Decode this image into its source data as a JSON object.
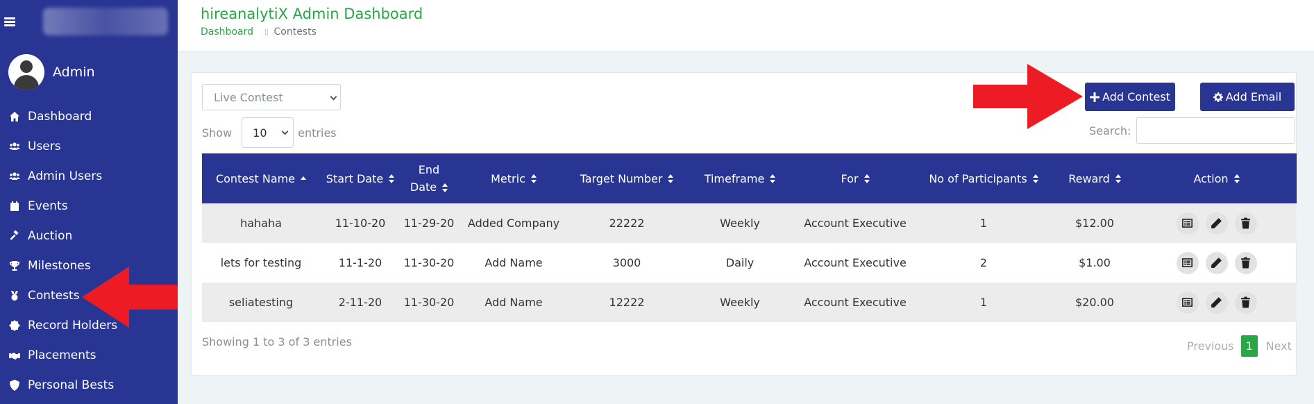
{
  "sidebar": {
    "user_name": "Admin",
    "items": [
      {
        "label": "Dashboard",
        "icon": "home-icon"
      },
      {
        "label": "Users",
        "icon": "users-icon"
      },
      {
        "label": "Admin Users",
        "icon": "users-icon"
      },
      {
        "label": "Events",
        "icon": "calendar-icon"
      },
      {
        "label": "Auction",
        "icon": "gavel-icon"
      },
      {
        "label": "Milestones",
        "icon": "trophy-icon"
      },
      {
        "label": "Contests",
        "icon": "medal-icon"
      },
      {
        "label": "Record Holders",
        "icon": "badge-icon"
      },
      {
        "label": "Placements",
        "icon": "handshake-icon"
      },
      {
        "label": "Personal Bests",
        "icon": "shield-icon"
      }
    ],
    "bg_color": "#283593"
  },
  "header": {
    "title": "hireanalytiX Admin Dashboard",
    "breadcrumb": {
      "home": "Dashboard",
      "current": "Contests"
    }
  },
  "toolbar": {
    "filter_value": "Live Contest",
    "show_label": "Show",
    "entries_value": "10",
    "entries_label": "entries",
    "add_contest": "Add Contest",
    "add_email": "Add Email",
    "search_label": "Search:"
  },
  "table": {
    "headers": [
      "Contest Name",
      "Start Date",
      "End Date",
      "Metric",
      "Target Number",
      "Timeframe",
      "For",
      "No of Participants",
      "Reward",
      "Action"
    ],
    "rows": [
      [
        "hahaha",
        "11-10-20",
        "11-29-20",
        "Added Company",
        "22222",
        "Weekly",
        "Account Executive",
        "1",
        "$12.00"
      ],
      [
        "lets for testing",
        "11-1-20",
        "11-30-20",
        "Add Name",
        "3000",
        "Daily",
        "Account Executive",
        "2",
        "$1.00"
      ],
      [
        "seliatesting",
        "2-11-20",
        "11-30-20",
        "Add Name",
        "12222",
        "Weekly",
        "Account Executive",
        "1",
        "$20.00"
      ]
    ],
    "info": "Showing 1 to 3 of 3 entries"
  },
  "pagination": {
    "previous": "Previous",
    "current": "1",
    "next": "Next"
  },
  "colors": {
    "accent": "#283593",
    "title_green": "#28a745",
    "arrow_red": "#ed1c24"
  }
}
